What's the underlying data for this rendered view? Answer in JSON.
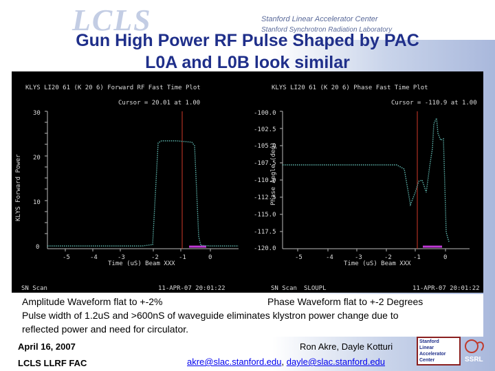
{
  "header": {
    "logo_text": "LCLS",
    "org_line1": "Stanford Linear Accelerator Center",
    "org_line2": "Stanford Synchrotron Radiation Laboratory"
  },
  "title": {
    "line1": "Gun High Power RF Pulse Shaped by PAC",
    "line2": "L0A and L0B look similar"
  },
  "left_plot": {
    "title": "KLYS LI20 61 (K 20 6) Forward RF Fast Time Plot",
    "cursor": "Cursor = 20.01 at 1.00",
    "ylabel": "KLYS Forward Power",
    "xlabel": "Time (uS) Beam XXX",
    "yticks": [
      "30",
      "20",
      "10",
      "0"
    ],
    "xticks": [
      "-5",
      "-4",
      "-3",
      "-2",
      "-1",
      "0"
    ],
    "footer_left": "SN Scan",
    "footer_right": "11-APR-07 20:01:22"
  },
  "right_plot": {
    "title": "KLYS LI20 61 (K 20 6) Phase Fast Time Plot",
    "cursor": "Cursor = -110.9 at 1.00",
    "ylabel": "Phase Angle (deg)",
    "xlabel": "Time (uS) Beam XXX",
    "yticks": [
      "-100.0",
      "-102.5",
      "-105.0",
      "-107.5",
      "-110.0",
      "-112.5",
      "-115.0",
      "-117.5",
      "-120.0"
    ],
    "xticks": [
      "-5",
      "-4",
      "-3",
      "-2",
      "-1",
      "0"
    ],
    "footer_left": "SN Scan",
    "footer_mid": "SLOUPL",
    "footer_right": "11-APR-07 20:01:22"
  },
  "notes": {
    "line1a": "Amplitude Waveform flat to +-2%",
    "line1b": "Phase Waveform flat to +-2 Degrees",
    "line2": "Pulse width of 1.2uS and >600nS of waveguide eliminates klystron power change due to",
    "line3": "reflected power and need for circulator."
  },
  "footer": {
    "date": "April 16, 2007",
    "org": "LCLS LLRF FAC",
    "authors": "Ron Akre, Dayle Kotturi",
    "email1": "akre@slac.stanford.edu",
    "sep": ", ",
    "email2": "dayle@slac.stanford.edu",
    "logo_lines": [
      "Stanford",
      "Linear",
      "Accelerator",
      "Center"
    ],
    "ssrl": "SSRL"
  },
  "colors": {
    "title": "#1f2f8a",
    "trace": "#5fb8b0",
    "cursor_line": "#c0392b",
    "marker": "#c03ad6"
  }
}
